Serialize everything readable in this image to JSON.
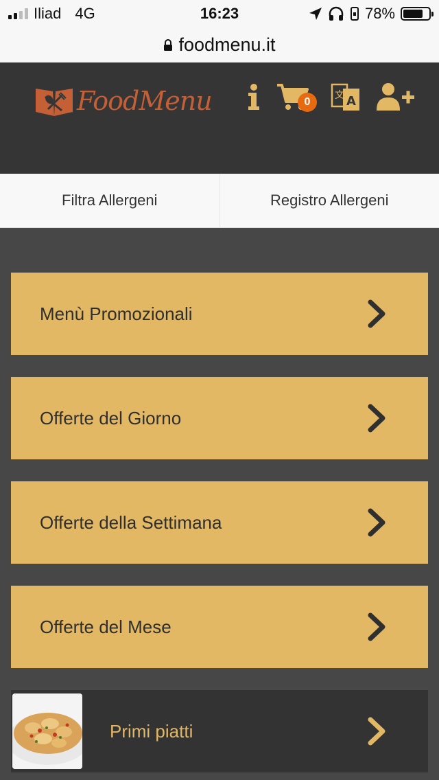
{
  "status_bar": {
    "carrier": "Iliad",
    "network": "4G",
    "time": "16:23",
    "battery": "78%",
    "battery_level": 0.78
  },
  "url_bar": {
    "url": "foodmenu.it"
  },
  "header": {
    "logo_text": "FoodMenu",
    "cart_count": "0",
    "icons": [
      "info-icon",
      "cart-icon",
      "translate-icon",
      "add-user-icon"
    ],
    "accent_color": "#e3b865",
    "brand_color": "#c45f36"
  },
  "tabs": [
    {
      "label": "Filtra Allergeni"
    },
    {
      "label": "Registro Allergeni"
    }
  ],
  "menu": {
    "items": [
      {
        "label": "Menù Promozionali"
      },
      {
        "label": "Offerte del Giorno"
      },
      {
        "label": "Offerte della Settimana"
      },
      {
        "label": "Offerte del Mese"
      },
      {
        "label": "Primi piatti"
      }
    ]
  }
}
